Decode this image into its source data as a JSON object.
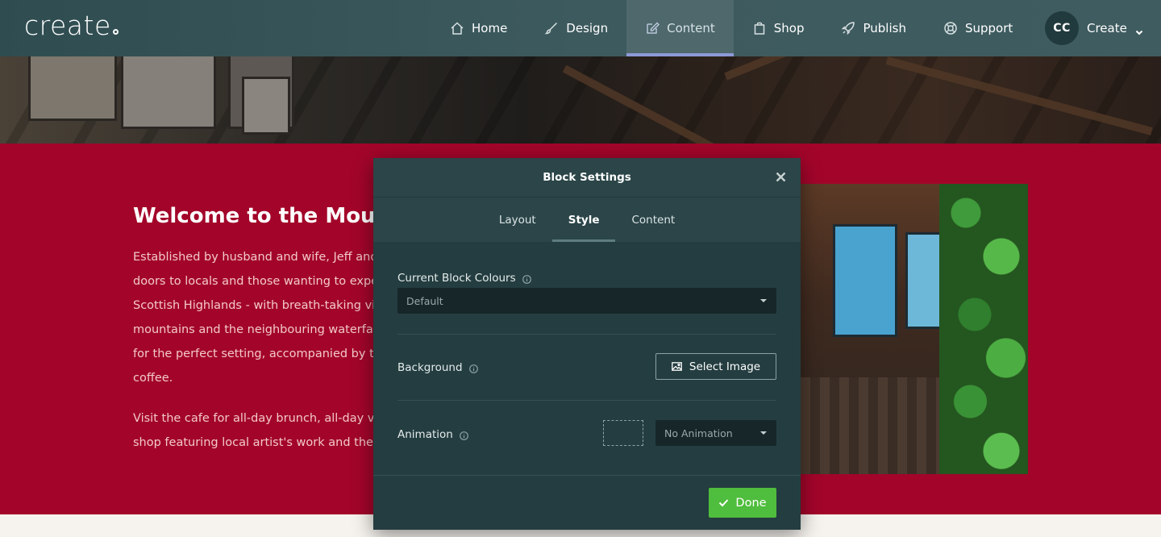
{
  "brand": {
    "logo_text": "create"
  },
  "nav": {
    "items": [
      {
        "label": "Home",
        "icon": "home-icon"
      },
      {
        "label": "Design",
        "icon": "brush-icon"
      },
      {
        "label": "Content",
        "icon": "edit-icon",
        "active": true
      },
      {
        "label": "Shop",
        "icon": "shopping-bag-icon"
      },
      {
        "label": "Publish",
        "icon": "rocket-icon"
      },
      {
        "label": "Support",
        "icon": "lifebuoy-icon"
      }
    ],
    "user": {
      "initials": "CC",
      "label": "Create"
    }
  },
  "page": {
    "welcome_title": "Welcome to the Mount",
    "para1": [
      "Established by husband and wife, Jeff and",
      "doors to locals and those wanting to exper",
      "Scottish Highlands - with breath-taking vie",
      "mountains and the neighbouring waterfall",
      "for the perfect setting, accompanied by th",
      "coffee."
    ],
    "para2": [
      "Visit the cafe for all-day brunch, all-day vie",
      "shop featuring local artist's work and the c"
    ]
  },
  "modal": {
    "title": "Block Settings",
    "tabs": [
      {
        "label": "Layout"
      },
      {
        "label": "Style",
        "active": true
      },
      {
        "label": "Content"
      }
    ],
    "colours": {
      "label": "Current Block Colours",
      "value": "Default"
    },
    "background": {
      "label": "Background",
      "button_label": "Select Image"
    },
    "animation": {
      "label": "Animation",
      "value": "No Animation"
    },
    "done_label": "Done"
  },
  "colors": {
    "nav_bg": "#3d5a5e",
    "nav_active_underline": "#8d99d6",
    "section_red": "#a3052a",
    "modal_bg": "#243d40",
    "done_green": "#4fbd3d"
  }
}
